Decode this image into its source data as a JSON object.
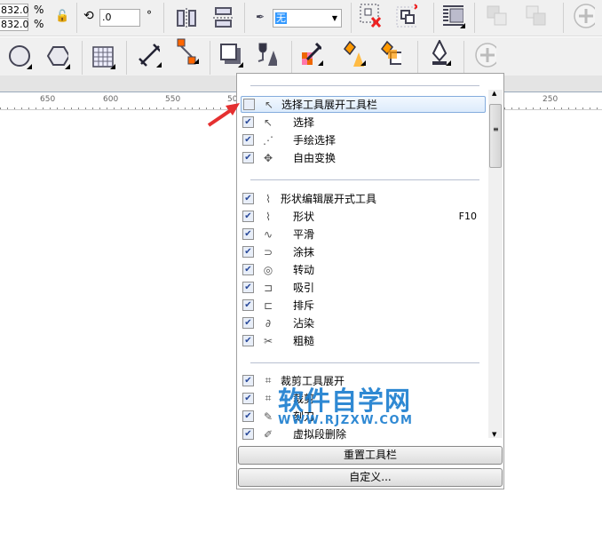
{
  "toolbar1": {
    "scale_x": "832.0",
    "scale_y": "832.0",
    "pct": "%",
    "rotation": ".0",
    "degree": "°",
    "outline_value": "无"
  },
  "toolbar2": {},
  "ruler": {
    "labels": [
      "650",
      "600",
      "550",
      "50",
      "250"
    ]
  },
  "menu": {
    "groups": [
      {
        "items": [
          {
            "label": "选择工具展开工具栏",
            "checked": false,
            "icon": "pointer-icon",
            "header": true,
            "highlighted": true
          },
          {
            "label": "选择",
            "checked": true,
            "icon": "pointer-icon"
          },
          {
            "label": "手绘选择",
            "checked": true,
            "icon": "freehand-pick-icon"
          },
          {
            "label": "自由变换",
            "checked": true,
            "icon": "free-transform-icon"
          }
        ]
      },
      {
        "items": [
          {
            "label": "形状编辑展开式工具",
            "checked": true,
            "icon": "shape-icon",
            "header": true
          },
          {
            "label": "形状",
            "checked": true,
            "icon": "shape-icon",
            "shortcut": "F10"
          },
          {
            "label": "平滑",
            "checked": true,
            "icon": "smooth-icon"
          },
          {
            "label": "涂抹",
            "checked": true,
            "icon": "smear-icon"
          },
          {
            "label": "转动",
            "checked": true,
            "icon": "twirl-icon"
          },
          {
            "label": "吸引",
            "checked": true,
            "icon": "attract-icon"
          },
          {
            "label": "排斥",
            "checked": true,
            "icon": "repel-icon"
          },
          {
            "label": "沾染",
            "checked": true,
            "icon": "smudge-icon"
          },
          {
            "label": "粗糙",
            "checked": true,
            "icon": "roughen-icon"
          }
        ]
      },
      {
        "items": [
          {
            "label": "裁剪工具展开",
            "checked": true,
            "icon": "crop-icon",
            "header": true
          },
          {
            "label": "裁剪",
            "checked": true,
            "icon": "crop-icon"
          },
          {
            "label": "刻刀",
            "checked": true,
            "icon": "knife-icon"
          },
          {
            "label": "虚拟段删除",
            "checked": true,
            "icon": "virtual-segment-delete-icon"
          }
        ]
      }
    ],
    "reset_label": "重置工具栏",
    "customize_label": "自定义..."
  },
  "watermark": {
    "title": "软件自学网",
    "url": "WWW.RJZXW.COM"
  },
  "colors": {
    "accent": "#1e7fd0",
    "highlight": "#dcebfc",
    "arrow": "#e53030"
  }
}
